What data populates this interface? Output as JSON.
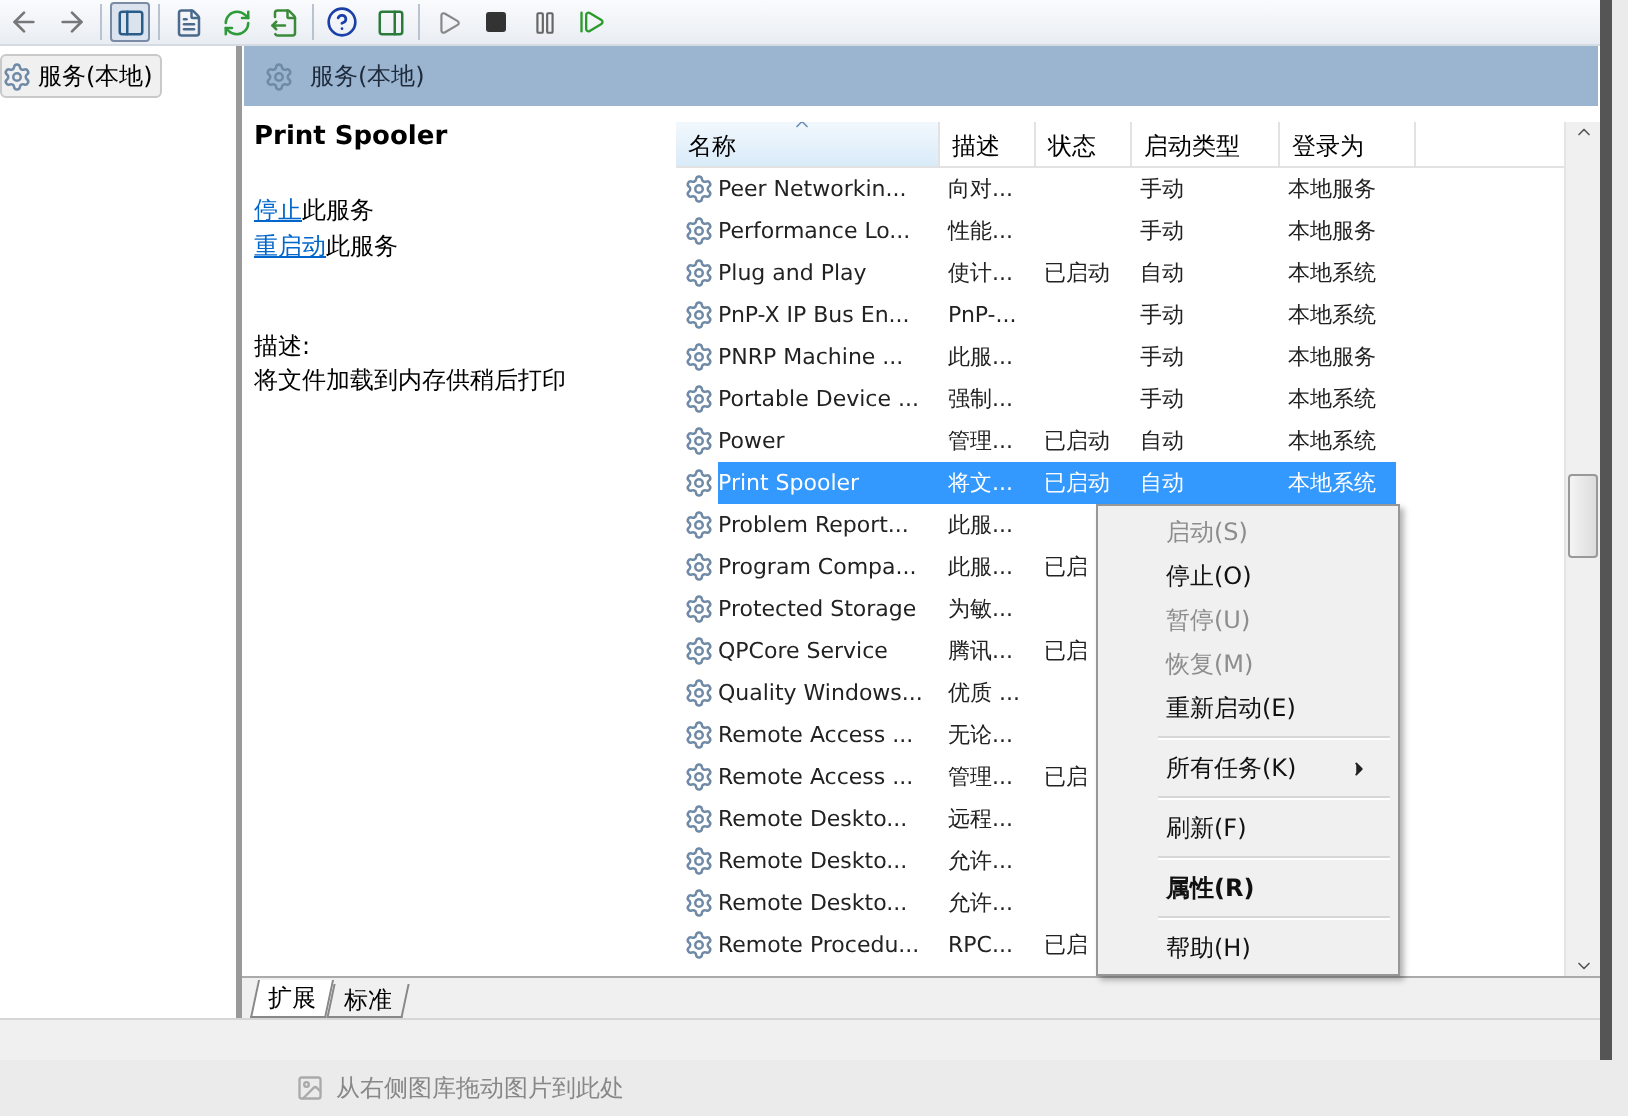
{
  "tree": {
    "items": [
      {
        "label": "服务(本地)",
        "selected": true
      }
    ]
  },
  "header": {
    "title": "服务(本地)"
  },
  "details": {
    "service_name": "Print Spooler",
    "actions": [
      {
        "link": "停止",
        "rest": "此服务"
      },
      {
        "link": "重启动",
        "rest": "此服务"
      }
    ],
    "description_label": "描述:",
    "description": "将文件加载到内存供稍后打印"
  },
  "table": {
    "columns": [
      {
        "label": "名称",
        "sorted": true
      },
      {
        "label": "描述",
        "sorted": false
      },
      {
        "label": "状态",
        "sorted": false
      },
      {
        "label": "启动类型",
        "sorted": false
      },
      {
        "label": "登录为",
        "sorted": false
      }
    ],
    "rows": [
      {
        "cells": [
          "Peer Networkin...",
          "向对...",
          "",
          "手动",
          "本地服务"
        ],
        "selected": false
      },
      {
        "cells": [
          "Performance Lo...",
          "性能...",
          "",
          "手动",
          "本地服务"
        ],
        "selected": false
      },
      {
        "cells": [
          "Plug and Play",
          "使计...",
          "已启动",
          "自动",
          "本地系统"
        ],
        "selected": false
      },
      {
        "cells": [
          "PnP-X IP Bus En...",
          "PnP-...",
          "",
          "手动",
          "本地系统"
        ],
        "selected": false
      },
      {
        "cells": [
          "PNRP Machine ...",
          "此服...",
          "",
          "手动",
          "本地服务"
        ],
        "selected": false
      },
      {
        "cells": [
          "Portable Device ...",
          "强制...",
          "",
          "手动",
          "本地系统"
        ],
        "selected": false
      },
      {
        "cells": [
          "Power",
          "管理...",
          "已启动",
          "自动",
          "本地系统"
        ],
        "selected": false
      },
      {
        "cells": [
          "Print Spooler",
          "将文...",
          "已启动",
          "自动",
          "本地系统"
        ],
        "selected": true
      },
      {
        "cells": [
          "Problem Report...",
          "此服...",
          "",
          "",
          ""
        ],
        "selected": false
      },
      {
        "cells": [
          "Program Compa...",
          "此服...",
          "已启",
          "",
          ""
        ],
        "selected": false
      },
      {
        "cells": [
          "Protected Storage",
          "为敏...",
          "",
          "",
          ""
        ],
        "selected": false
      },
      {
        "cells": [
          "QPCore Service",
          "腾讯...",
          "已启",
          "",
          ""
        ],
        "selected": false
      },
      {
        "cells": [
          "Quality Windows...",
          "优质 ...",
          "",
          "",
          ""
        ],
        "selected": false
      },
      {
        "cells": [
          "Remote Access ...",
          "无论...",
          "",
          "",
          ""
        ],
        "selected": false
      },
      {
        "cells": [
          "Remote Access ...",
          "管理...",
          "已启",
          "",
          ""
        ],
        "selected": false
      },
      {
        "cells": [
          "Remote Deskto...",
          "远程...",
          "",
          "",
          ""
        ],
        "selected": false
      },
      {
        "cells": [
          "Remote Deskto...",
          "允许...",
          "",
          "",
          ""
        ],
        "selected": false
      },
      {
        "cells": [
          "Remote Deskto...",
          "允许...",
          "",
          "",
          ""
        ],
        "selected": false
      },
      {
        "cells": [
          "Remote Procedu...",
          "RPC...",
          "已启",
          "",
          ""
        ],
        "selected": false
      }
    ]
  },
  "tabs": [
    {
      "label": "扩展",
      "selected": true
    },
    {
      "label": "标准",
      "selected": false
    }
  ],
  "context_menu": {
    "items": [
      {
        "kind": "item",
        "label": "启动(S)",
        "disabled": true
      },
      {
        "kind": "item",
        "label": "停止(O)",
        "disabled": false
      },
      {
        "kind": "item",
        "label": "暂停(U)",
        "disabled": true
      },
      {
        "kind": "item",
        "label": "恢复(M)",
        "disabled": true
      },
      {
        "kind": "item",
        "label": "重新启动(E)",
        "disabled": false
      },
      {
        "kind": "separator"
      },
      {
        "kind": "submenu",
        "label": "所有任务(K)",
        "disabled": false
      },
      {
        "kind": "separator"
      },
      {
        "kind": "item",
        "label": "刷新(F)",
        "disabled": false
      },
      {
        "kind": "separator"
      },
      {
        "kind": "default",
        "label": "属性(R)",
        "disabled": false
      },
      {
        "kind": "separator"
      },
      {
        "kind": "item",
        "label": "帮助(H)",
        "disabled": false
      }
    ]
  },
  "below_window_hint": "从右侧图库拖动图片到此处"
}
